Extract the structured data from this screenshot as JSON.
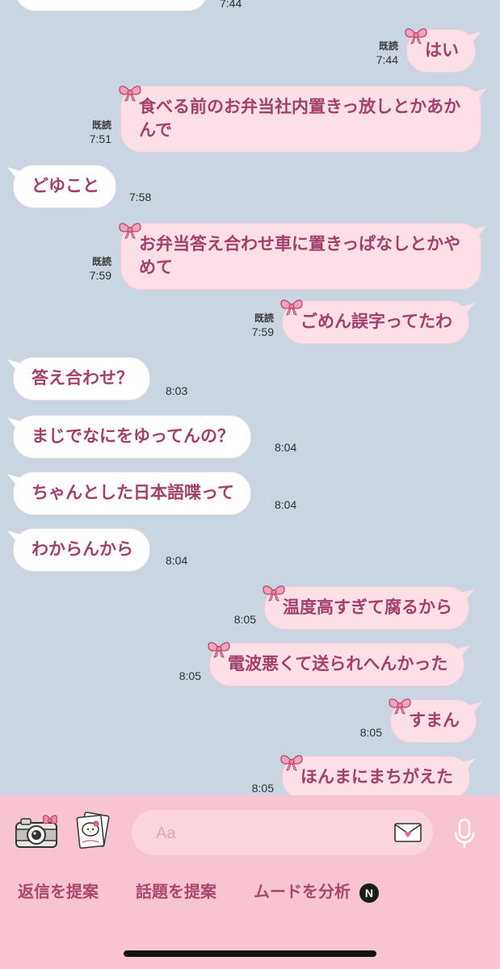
{
  "messages": [
    {
      "dir": "in",
      "text": "",
      "time": "7:44"
    },
    {
      "dir": "out",
      "text": "はい",
      "time": "7:44",
      "read": "既読"
    },
    {
      "dir": "out",
      "text": "食べる前のお弁当社内置きっ放しとかあかんで",
      "time": "7:51",
      "read": "既読"
    },
    {
      "dir": "in",
      "text": "どゆこと",
      "time": "7:58"
    },
    {
      "dir": "out",
      "text": "お弁当答え合わせ車に置きっぱなしとかやめて",
      "time": "7:59",
      "read": "既読"
    },
    {
      "dir": "out",
      "text": "ごめん誤字ってたわ",
      "time": "7:59",
      "read": "既読"
    },
    {
      "dir": "in",
      "text": "答え合わせ？",
      "time": "8:03"
    },
    {
      "dir": "in",
      "text": "まじでなにをゆってんの？",
      "time": "8:04"
    },
    {
      "dir": "in",
      "text": "ちゃんとした日本語喋って",
      "time": "8:04"
    },
    {
      "dir": "in",
      "text": "わからんから",
      "time": "8:04"
    },
    {
      "dir": "out",
      "text": "温度高すぎて腐るから",
      "time": "8:05"
    },
    {
      "dir": "out",
      "text": "電波悪くて送られへんかった",
      "time": "8:05"
    },
    {
      "dir": "out",
      "text": "すまん",
      "time": "8:05"
    },
    {
      "dir": "out",
      "text": "ほんまにまちがえた",
      "time": "8:05"
    }
  ],
  "input": {
    "placeholder": "Aa",
    "value": ""
  },
  "toolbar": {
    "camera_icon": "camera-icon",
    "sticker_icon": "sticker-album-icon",
    "letter_icon": "letter-icon",
    "mic_icon": "microphone-icon"
  },
  "suggestions": [
    {
      "label": "返信を提案"
    },
    {
      "label": "話題を提案"
    },
    {
      "label": "ムードを分析",
      "badge": "N"
    }
  ],
  "colors": {
    "chat_background": "#c9d5e1",
    "incoming_bubble": "#ffffff",
    "outgoing_bubble": "#fde0e7",
    "message_text": "#a23f6b",
    "bottom_bar": "#f9c4d1"
  }
}
